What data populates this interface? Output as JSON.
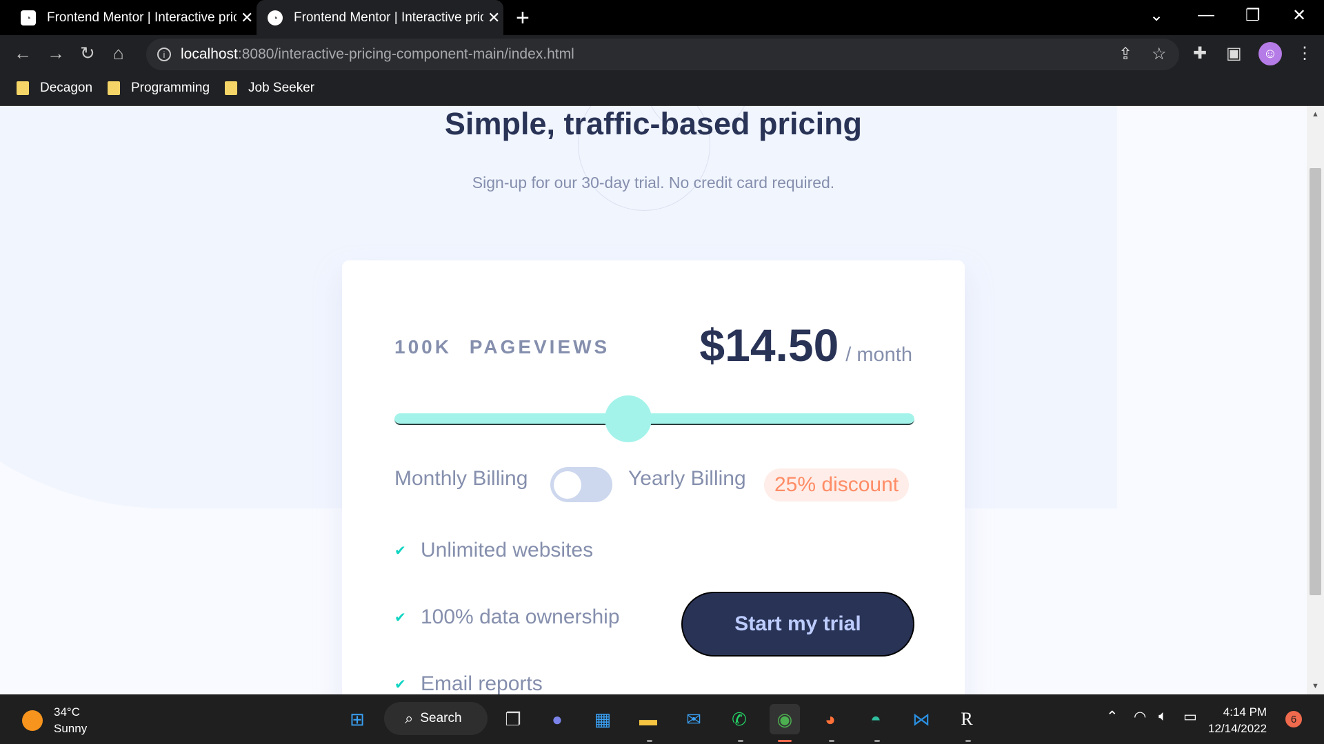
{
  "browser": {
    "tabs": [
      {
        "title": "Frontend Mentor | Interactive pricing component",
        "close": "✕"
      },
      {
        "title": "Frontend Mentor | Interactive pricing component",
        "close": "✕"
      }
    ],
    "new_tab": "+",
    "url_host": "localhost",
    "url_rest": ":8080/interactive-pricing-component-main/index.html",
    "bookmarks": [
      "Decagon",
      "Programming",
      "Job Seeker"
    ]
  },
  "page": {
    "headline": "Simple, traffic-based pricing",
    "subtitle": "Sign-up for our 30-day trial. No credit card required.",
    "pageviews": "100K PAGEVIEWS",
    "price": "$14.50",
    "period": "/ month",
    "slider_value_fraction": 0.45,
    "monthly_label": "Monthly Billing",
    "yearly_label": "Yearly Billing",
    "discount": "25% discount",
    "features": [
      "Unlimited websites",
      "100% data ownership",
      "Email reports"
    ],
    "cta": "Start my trial",
    "colors": {
      "accent": "#a4f3eb",
      "dark": "#293356",
      "discount_text": "#ff8c66",
      "check": "#10d5c2"
    }
  },
  "taskbar": {
    "temp": "34°C",
    "condition": "Sunny",
    "search": "Search",
    "time": "4:14 PM",
    "date": "12/14/2022",
    "notifications": "6"
  }
}
